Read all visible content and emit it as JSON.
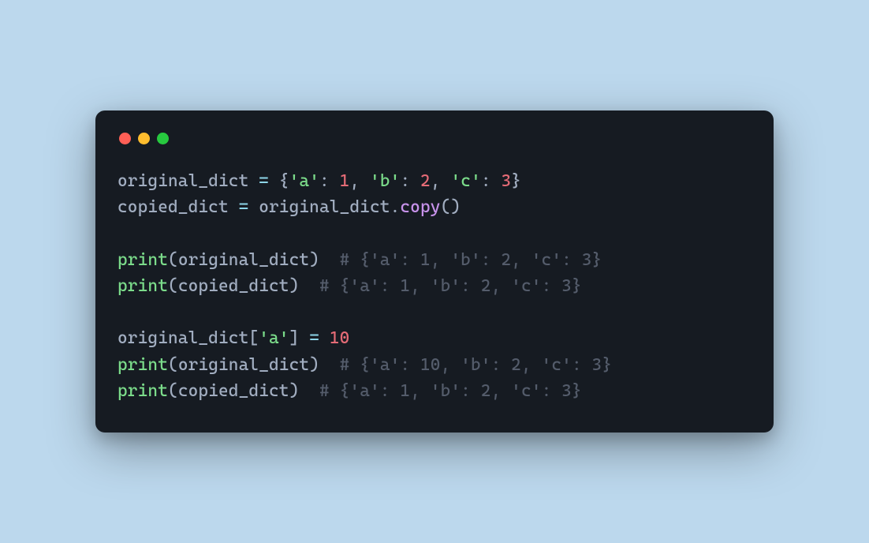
{
  "code": {
    "l1": {
      "ident1": "original_dict",
      "eq": " = ",
      "open": "{",
      "s1": "'a'",
      "c1": ": ",
      "n1": "1",
      "sep1": ", ",
      "s2": "'b'",
      "c2": ": ",
      "n2": "2",
      "sep2": ", ",
      "s3": "'c'",
      "c3": ": ",
      "n3": "3",
      "close": "}"
    },
    "l2": {
      "ident1": "copied_dict",
      "eq": " = ",
      "ident2": "original_dict",
      "dot": ".",
      "method": "copy",
      "paren": "()"
    },
    "blank1": " ",
    "l4": {
      "fn": "print",
      "open": "(",
      "arg": "original_dict",
      "close": ")",
      "pad": "  ",
      "comment": "# {'a': 1, 'b': 2, 'c': 3}"
    },
    "l5": {
      "fn": "print",
      "open": "(",
      "arg": "copied_dict",
      "close": ")",
      "pad": "  ",
      "comment": "# {'a': 1, 'b': 2, 'c': 3}"
    },
    "blank2": " ",
    "l7": {
      "ident1": "original_dict",
      "open": "[",
      "key": "'a'",
      "close": "]",
      "eq": " = ",
      "val": "10"
    },
    "l8": {
      "fn": "print",
      "open": "(",
      "arg": "original_dict",
      "close": ")",
      "pad": "  ",
      "comment": "# {'a': 10, 'b': 2, 'c': 3}"
    },
    "l9": {
      "fn": "print",
      "open": "(",
      "arg": "copied_dict",
      "close": ")",
      "pad": "  ",
      "comment": "# {'a': 1, 'b': 2, 'c': 3}"
    }
  }
}
